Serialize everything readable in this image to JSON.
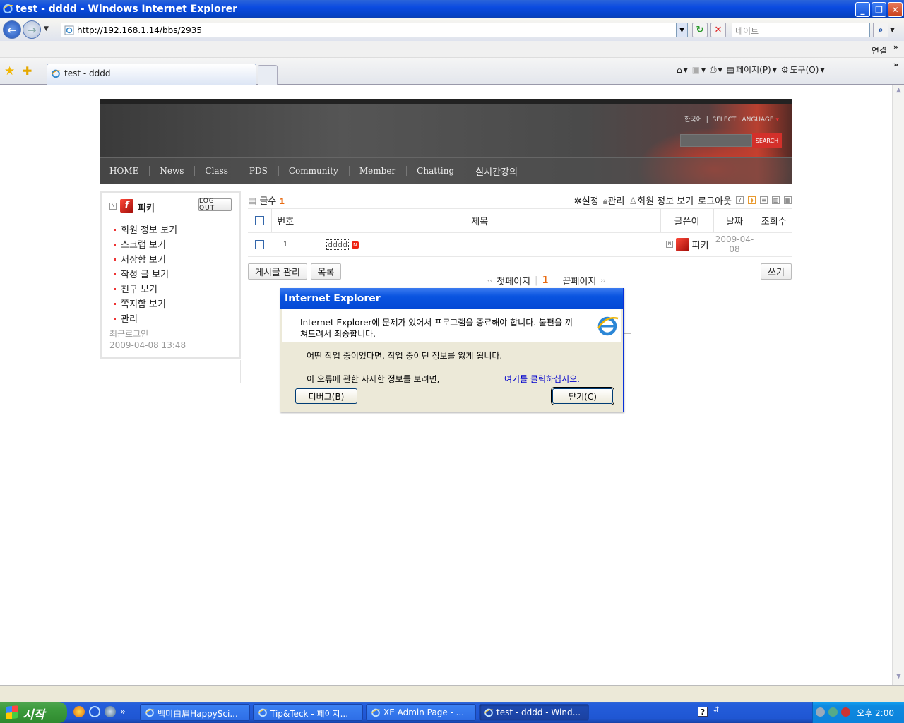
{
  "window": {
    "title": "test - dddd - Windows Internet Explorer",
    "minimize_glyph": "_",
    "restore_glyph": "❐",
    "close_glyph": "✕"
  },
  "address_bar": {
    "url": "http://192.168.1.14/bbs/2935",
    "search_placeholder": "네이트"
  },
  "links_bar": {
    "label": "연결",
    "chevron": "»"
  },
  "tabs": [
    {
      "label": "test - dddd"
    }
  ],
  "command_bar": {
    "page_label": "페이지(P)",
    "tools_label": "도구(O)",
    "chevron": "»"
  },
  "site": {
    "language": "한국어",
    "language_separator": "|",
    "select_language": "SELECT LANGUAGE",
    "search_button": "SEARCH",
    "nav": [
      "HOME",
      "News",
      "Class",
      "PDS",
      "Community",
      "Member",
      "Chatting",
      "실시간강의"
    ]
  },
  "login_box": {
    "username": "피키",
    "logout_label": "LOG OUT",
    "menu": [
      "회원 정보 보기",
      "스크랩 보기",
      "저장함 보기",
      "작성 글 보기",
      "친구 보기",
      "쪽지함 보기",
      "관리"
    ],
    "last_login_label": "최근로그인",
    "last_login_time": "2009-04-08 13:48"
  },
  "board": {
    "post_count_label": "글수",
    "post_count": "1",
    "tools": {
      "settings": "설정",
      "admin": "관리",
      "member_info": "회원 정보 보기",
      "logout": "로그아웃"
    },
    "columns": {
      "number": "번호",
      "title": "제목",
      "author": "글쓴이",
      "date": "날짜",
      "views": "조회수"
    },
    "rows": [
      {
        "number": "1",
        "title": "dddd",
        "new_badge": "N",
        "author": "피키",
        "date": "2009-04-08",
        "views": ""
      }
    ],
    "manage_button": "게시글 관리",
    "list_button": "목록",
    "write_button": "쓰기",
    "pagination": {
      "first_arrows": "‹‹",
      "first": "첫페이지",
      "separator": "|",
      "current": "1",
      "last": "끝페이지",
      "last_arrows": "››"
    }
  },
  "dialog": {
    "title": "Internet Explorer",
    "message": "Internet Explorer에 문제가 있어서 프로그램을 종료해야 합니다. 불편을 끼쳐드려서 죄송합니다.",
    "warning": "어떤 작업 중이었다면, 작업 중이던 정보를 잃게 됩니다.",
    "info": "이 오류에 관한 자세한 정보를 보려면,",
    "link": "여기를 클릭하십시오.",
    "debug_button": "디버그(B)",
    "close_button": "닫기(C)"
  },
  "taskbar": {
    "start_label": "시작",
    "quicklaunch_chevron": "»",
    "tasks": [
      {
        "label": "백미白眉HappySci..."
      },
      {
        "label": "Tip&Teck - 페이지..."
      },
      {
        "label": "XE Admin Page - ..."
      },
      {
        "label": "test - dddd - Wind..."
      }
    ],
    "clock": "오후 2:00"
  },
  "colors": {
    "xp_blue": "#0543c8",
    "accent_red": "#d3302a",
    "accent_orange": "#e86a10",
    "start_green": "#3b9a3b"
  }
}
